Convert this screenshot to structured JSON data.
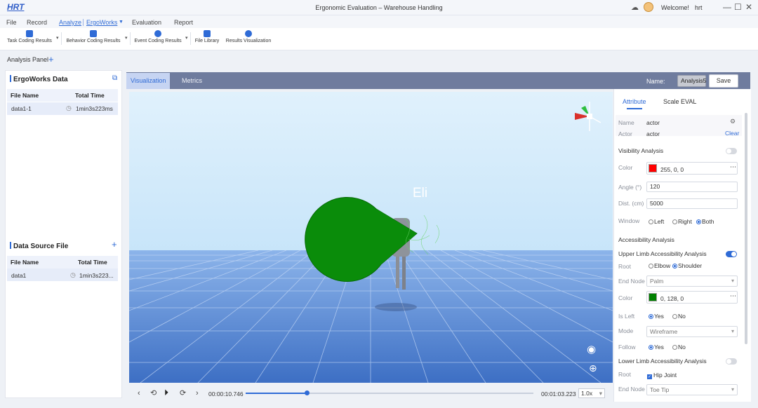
{
  "app": {
    "logo": "HRT",
    "window_title": "Ergonomic Evaluation – Warehouse Handling",
    "welcome": "Welcome!",
    "username": "hrt",
    "win_minimize": "—",
    "win_maximize": "☐",
    "win_close": "✕",
    "cloud_glyph": "☁"
  },
  "menu": {
    "items": [
      "File",
      "Record",
      "Analyze",
      "ErgoWorks",
      "Evaluation",
      "Report"
    ],
    "active": "Analyze"
  },
  "toolbar": {
    "items": [
      "Task Coding Results",
      "Behavior Coding Results",
      "Event Coding Results",
      "File Library",
      "Results Visualization"
    ],
    "accent": "#2f6bd6"
  },
  "analysis_panel": {
    "label": "Analysis Panel",
    "add": "+"
  },
  "left": {
    "ergoworks": {
      "title": "ErgoWorks Data",
      "columns": [
        "File Name",
        "Total Time"
      ],
      "rows": [
        {
          "name": "data1-1",
          "time": "1min3s223ms"
        }
      ]
    },
    "datasource": {
      "title": "Data Source File",
      "add": "+",
      "columns": [
        "File Name",
        "Total Time"
      ],
      "rows": [
        {
          "name": "data1",
          "time": "1min3s223..."
        }
      ]
    }
  },
  "viz": {
    "tabs": [
      "Visualization",
      "Metrics"
    ],
    "active_tab": "Visualization",
    "name_label": "Name:",
    "name_value": "Analysis5",
    "save": "Save",
    "actor_label": "Eli",
    "playback": {
      "current_time": "00:00:10.746",
      "total_time": "00:01:03.223",
      "speed": "1.0x",
      "progress": 0.213
    }
  },
  "right": {
    "tabs": [
      "Attribute",
      "Scale EVAL"
    ],
    "active_tab": "Attribute",
    "name_label": "Name",
    "name_value": "actor",
    "actor_label": "Actor",
    "actor_value": "actor",
    "clear": "Clear",
    "visibility": {
      "title": "Visibility Analysis",
      "enabled": false,
      "color_label": "Color",
      "color_value": "255, 0, 0",
      "color_hex": "#ff0000",
      "angle_label": "Angle (°)",
      "angle_value": "120",
      "dist_label": "Dist. (cm)",
      "dist_value": "5000",
      "window_label": "Window",
      "window_options": [
        "Left",
        "Right",
        "Both"
      ],
      "window_selected": "Both"
    },
    "accessibility": {
      "title": "Accessibility Analysis",
      "upper": {
        "title": "Upper Limb Accessibility Analysis",
        "enabled": true,
        "root_label": "Root",
        "root_options": [
          "Elbow",
          "Shoulder"
        ],
        "root_selected": "Shoulder",
        "end_node_label": "End Node",
        "end_node_value": "Palm",
        "color_label": "Color",
        "color_value": "0, 128, 0",
        "color_hex": "#008000",
        "isleft_label": "Is Left",
        "isleft_options": [
          "Yes",
          "No"
        ],
        "isleft_selected": "Yes",
        "mode_label": "Mode",
        "mode_value": "Wireframe",
        "follow_label": "Follow",
        "follow_options": [
          "Yes",
          "No"
        ],
        "follow_selected": "Yes"
      },
      "lower": {
        "title": "Lower Limb Accessibility Analysis",
        "enabled": false,
        "root_label": "Root",
        "root_value": "Hip Joint",
        "end_node_label": "End Node",
        "end_node_value": "Toe Tip"
      }
    }
  }
}
